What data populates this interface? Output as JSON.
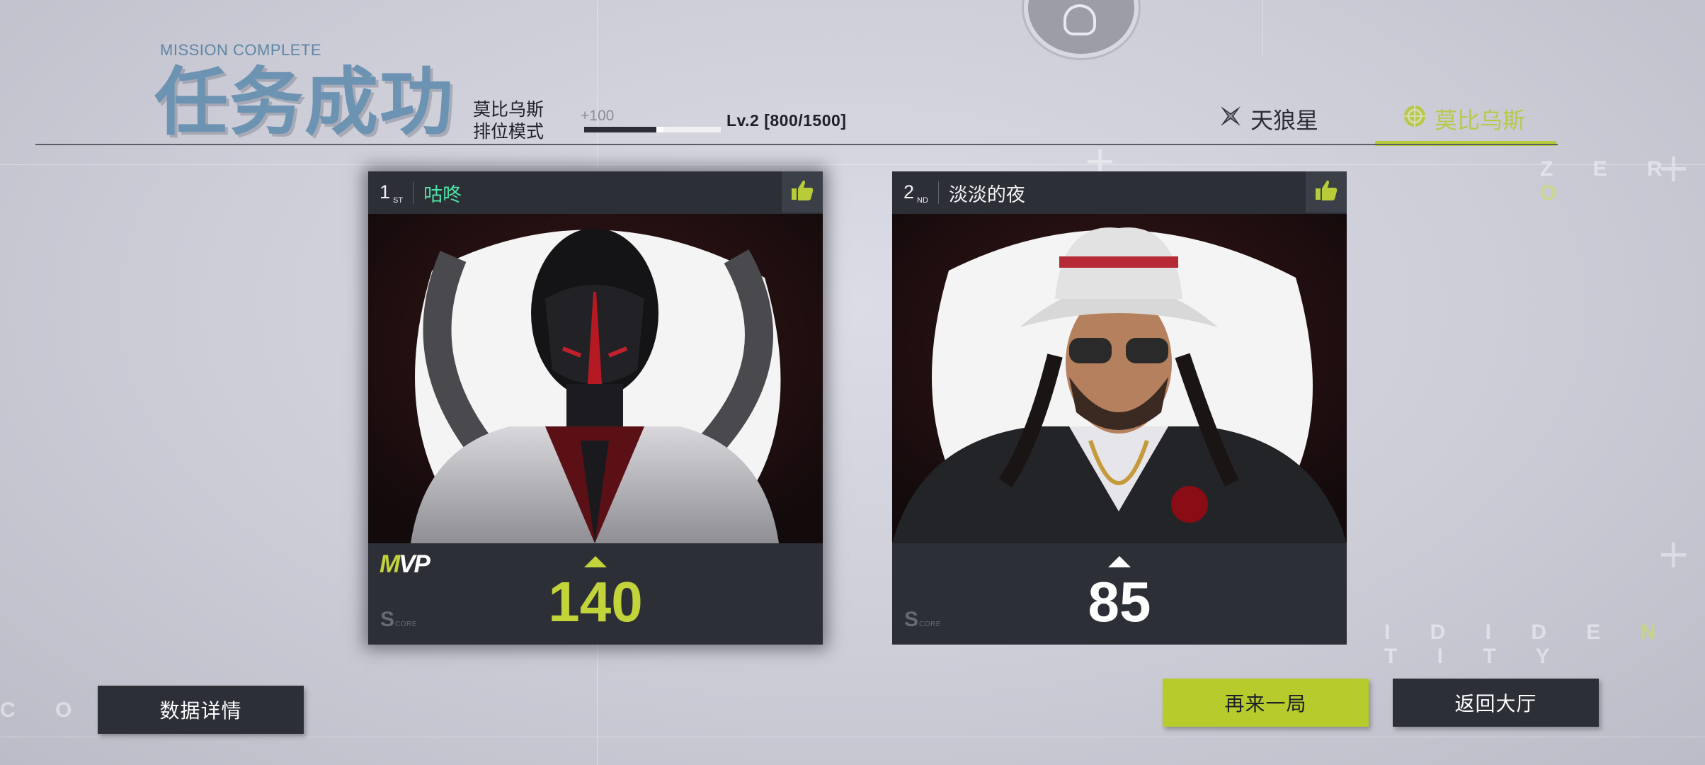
{
  "header": {
    "subtitle": "MISSION COMPLETE",
    "title": "任务成功",
    "mode_line1": "莫比乌斯",
    "mode_line2": "排位模式",
    "xp_gain": "+100",
    "xp_progress": 0.53,
    "level_text": "Lv.2  [800/1500]"
  },
  "teams": [
    {
      "name": "天狼星",
      "icon": "sirius-star-icon",
      "selected": false
    },
    {
      "name": "莫比乌斯",
      "icon": "mobius-emblem-icon",
      "selected": true
    }
  ],
  "players": [
    {
      "rank_num": "1",
      "rank_suffix": "ST",
      "name": "咕咚",
      "likes": "x1",
      "mvp_m": "M",
      "mvp_vp": "VP",
      "score": "140",
      "score_label_big": "S",
      "score_label_small": "CORE",
      "name_color": "#4fe3a6"
    },
    {
      "rank_num": "2",
      "rank_suffix": "ND",
      "name": "淡淡的夜",
      "score": "85",
      "score_label_big": "S",
      "score_label_small": "CORE",
      "name_color": "#f2f2f2"
    }
  ],
  "buttons": {
    "data_details": "数据详情",
    "play_again": "再来一局",
    "back_to_lobby": "返回大厅"
  },
  "background": {
    "word_left": "C O N",
    "word_right_a": "I D  I D E ",
    "word_right_hl": "N",
    "word_right_b": " T I T Y",
    "word_top_right": "Z E R ",
    "word_top_right_hl": "O"
  },
  "colors": {
    "accent_lime": "#b7cb2c",
    "title_blue": "#6c93b2",
    "card_dark": "#2c2f36"
  }
}
